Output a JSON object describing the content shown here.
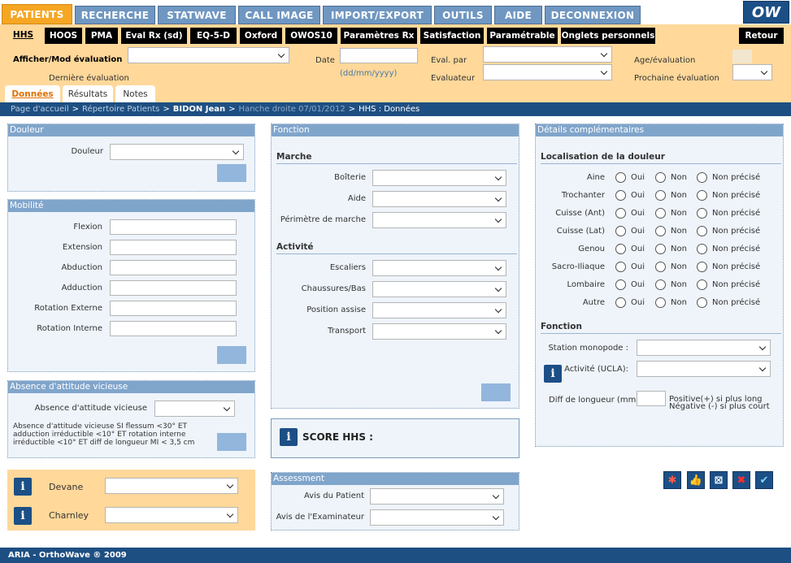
{
  "main_tabs": [
    "PATIENTS",
    "RECHERCHE",
    "STATWAVE",
    "CALL IMAGE",
    "IMPORT/EXPORT",
    "OUTILS",
    "AIDE",
    "DECONNEXION"
  ],
  "logo_text": "OW",
  "sub_tabs": [
    "HHS",
    "HOOS",
    "PMA",
    "Eval Rx (sd)",
    "EQ-5-D",
    "Oxford",
    "OWOS10",
    "Paramètres Rx",
    "Satisfaction",
    "Paramétrable",
    "Onglets personnels"
  ],
  "retour_label": "Retour",
  "eval_header": {
    "afficher_label": "Afficher/Mod évaluation",
    "derniere_label": "Dernière évaluation",
    "date_label": "Date",
    "date_hint": "(dd/mm/yyyy)",
    "eval_par_label": "Eval. par",
    "evaluateur_label": "Evaluateur",
    "age_label": "Age/évaluation",
    "prochaine_label": "Prochaine évaluation"
  },
  "page_tabs": [
    "Données",
    "Résultats",
    "Notes"
  ],
  "breadcrumb": {
    "home": "Page d'accueil",
    "repertoire": "Répertoire Patients",
    "patient": "BIDON Jean",
    "hanche": "Hanche droite 07/01/2012",
    "current": "HHS : Données",
    "separator": ">"
  },
  "douleur": {
    "title": "Douleur",
    "label": "Douleur"
  },
  "mobilite": {
    "title": "Mobilité",
    "fields": [
      "Flexion",
      "Extension",
      "Abduction",
      "Adduction",
      "Rotation Externe",
      "Rotation Interne"
    ]
  },
  "absence": {
    "title": "Absence d'attitude vicieuse",
    "label": "Absence d'attitude vicieuse",
    "note_lines": [
      "Absence d'attitude vicieuse SI flessum <30° ET",
      "adduction irréductible <10° ET rotation interne",
      "irréductible <10° ET diff de longueur MI < 3,5 cm"
    ]
  },
  "scores": {
    "devane": "Devane",
    "charnley": "Charnley"
  },
  "fonction": {
    "title": "Fonction",
    "marche_title": "Marche",
    "marche_fields": [
      "Boîterie",
      "Aide",
      "Périmètre de marche"
    ],
    "activite_title": "Activité",
    "activite_fields": [
      "Escaliers",
      "Chaussures/Bas",
      "Position assise",
      "Transport"
    ]
  },
  "score_hhs": "SCORE HHS :",
  "assessment": {
    "title": "Assessment",
    "fields": [
      "Avis du Patient",
      "Avis de l'Examinateur"
    ]
  },
  "details": {
    "title": "Détails complémentaires",
    "localisation_title": "Localisation de la douleur",
    "options": [
      "Oui",
      "Non",
      "Non précisé"
    ],
    "rows": [
      "Aine",
      "Trochanter",
      "Cuisse (Ant)",
      "Cuisse (Lat)",
      "Genou",
      "Sacro-Iliaque",
      "Lombaire",
      "Autre"
    ],
    "fonction_title": "Fonction",
    "station_label": "Station monopode :",
    "activite_label": "Activité (UCLA):",
    "diff_label": "Diff de longueur (mm)",
    "positive_note": "Positive(+) si plus long",
    "negative_note": "Négative (-) si plus court"
  },
  "footer": "ARIA - OrthoWave ® 2009",
  "action_icons": [
    "asterisk-icon",
    "thumbs-up-icon",
    "cancel-box-icon",
    "delete-icon",
    "validate-icon"
  ],
  "colors": {
    "orange": "#f5a623",
    "light_orange": "#ffd89a",
    "navy": "#1e4f82",
    "panel_blue": "#80a5cb"
  }
}
